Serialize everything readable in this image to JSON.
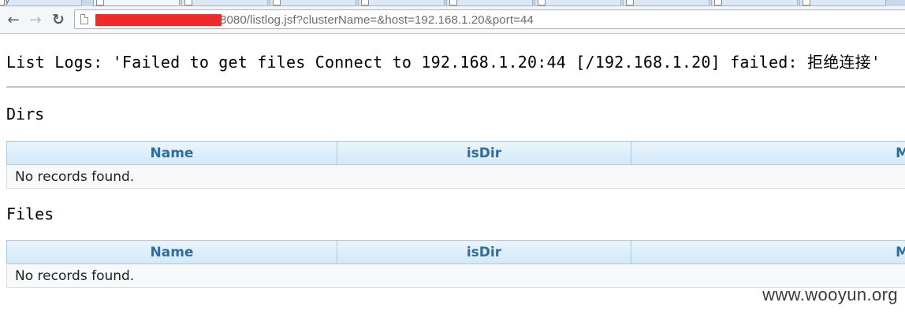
{
  "browser": {
    "tabs": [
      {
        "title": "y"
      },
      {
        "title": ""
      },
      {
        "title": ""
      },
      {
        "title": ""
      },
      {
        "title": ""
      },
      {
        "title": ""
      },
      {
        "title": ""
      },
      {
        "title": ""
      },
      {
        "title": ""
      },
      {
        "title": ""
      }
    ],
    "back_icon": "arrow-left-icon",
    "forward_icon": "arrow-right-icon",
    "reload_icon": "reload-icon",
    "url_visible": "8080/listlog.jsf?clusterName=&host=192.168.1.20&port=44"
  },
  "page": {
    "heading": "List Logs: 'Failed to get files Connect to 192.168.1.20:44 [/192.168.1.20] failed: 拒绝连接'",
    "dirs_section": {
      "title": "Dirs",
      "columns": [
        "Name",
        "isDir",
        "M"
      ],
      "empty_message": "No records found."
    },
    "files_section": {
      "title": "Files",
      "columns": [
        "Name",
        "isDir",
        "M"
      ],
      "empty_message": "No records found."
    }
  },
  "watermark": "www.wooyun.org",
  "colors": {
    "redaction": "#ee2a2a",
    "grid_header_text": "#2e6e9e",
    "grid_header_border": "#a8cbe4"
  }
}
